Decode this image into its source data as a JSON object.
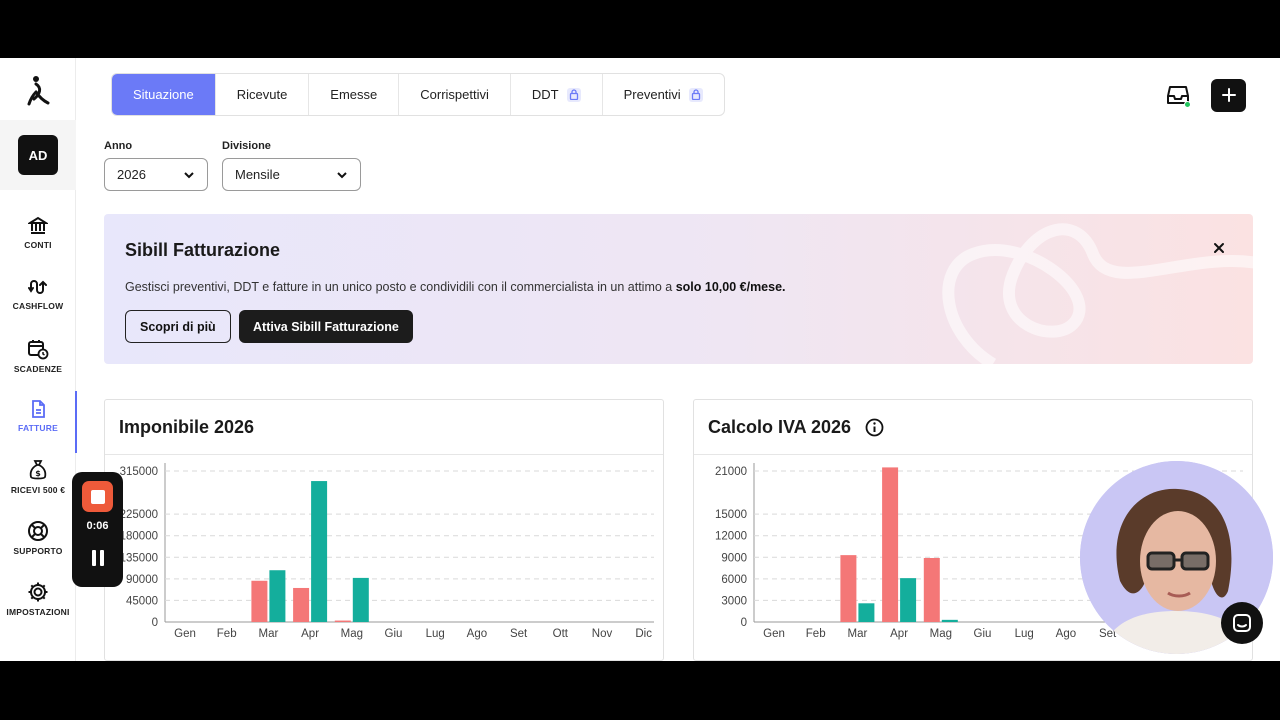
{
  "sidebar": {
    "avatar": "AD",
    "items": [
      {
        "label": "CONTI",
        "icon": "bank-icon"
      },
      {
        "label": "CASHFLOW",
        "icon": "cashflow-icon"
      },
      {
        "label": "SCADENZE",
        "icon": "calendar-clock-icon"
      },
      {
        "label": "FATTURE",
        "icon": "document-icon",
        "active": true
      },
      {
        "label": "RICEVI 500 €",
        "icon": "money-bag-icon"
      },
      {
        "label": "SUPPORTO",
        "icon": "lifebuoy-icon"
      },
      {
        "label": "IMPOSTAZIONI",
        "icon": "gear-icon"
      }
    ]
  },
  "tabs": [
    {
      "label": "Situazione",
      "active": true
    },
    {
      "label": "Ricevute"
    },
    {
      "label": "Emesse"
    },
    {
      "label": "Corrispettivi"
    },
    {
      "label": "DDT",
      "locked": true
    },
    {
      "label": "Preventivi",
      "locked": true
    }
  ],
  "filters": {
    "anno": {
      "label": "Anno",
      "value": "2026"
    },
    "divisione": {
      "label": "Divisione",
      "value": "Mensile"
    }
  },
  "banner": {
    "title": "Sibill Fatturazione",
    "text": "Gestisci preventivi, DDT e fatture in un unico posto e condividili con il commercialista in un attimo a ",
    "text_bold": "solo 10,00 €/mese.",
    "secondary_button": "Scopri di più",
    "primary_button": "Attiva Sibill Fatturazione"
  },
  "recorder": {
    "time": "0:06"
  },
  "colors": {
    "accent": "#6b7af7",
    "series_red": "#f47777",
    "series_teal": "#14ae9c"
  },
  "chart_data": [
    {
      "type": "bar",
      "title": "Imponibile 2026",
      "categories": [
        "Gen",
        "Feb",
        "Mar",
        "Apr",
        "Mag",
        "Giu",
        "Lug",
        "Ago",
        "Set",
        "Ott",
        "Nov",
        "Dic"
      ],
      "yticks": [
        "315000",
        "225000",
        "180000",
        "135000",
        "90000",
        "45000",
        "0"
      ],
      "ytick_values": [
        315000,
        225000,
        180000,
        135000,
        90000,
        45000,
        0
      ],
      "ylim": [
        0,
        315000
      ],
      "series": [
        {
          "color": "#f47777",
          "values": [
            0,
            0,
            86000,
            71000,
            3000,
            0,
            0,
            0,
            0,
            0,
            0,
            0
          ]
        },
        {
          "color": "#14ae9c",
          "values": [
            0,
            0,
            108000,
            294000,
            92000,
            0,
            0,
            0,
            0,
            0,
            0,
            0
          ]
        }
      ],
      "grid": true
    },
    {
      "type": "bar",
      "title": "Calcolo IVA 2026",
      "categories": [
        "Gen",
        "Feb",
        "Mar",
        "Apr",
        "Mag",
        "Giu",
        "Lug",
        "Ago",
        "Set"
      ],
      "yticks": [
        "21000",
        "15000",
        "12000",
        "9000",
        "6000",
        "3000",
        "0"
      ],
      "ytick_values": [
        21000,
        15000,
        12000,
        9000,
        6000,
        3000,
        0
      ],
      "ylim": [
        0,
        21000
      ],
      "series": [
        {
          "color": "#f47777",
          "values": [
            0,
            0,
            9300,
            21500,
            8900,
            0,
            0,
            0,
            0
          ]
        },
        {
          "color": "#14ae9c",
          "values": [
            0,
            0,
            2600,
            6100,
            300,
            0,
            0,
            0,
            0
          ]
        }
      ],
      "grid": true
    }
  ]
}
